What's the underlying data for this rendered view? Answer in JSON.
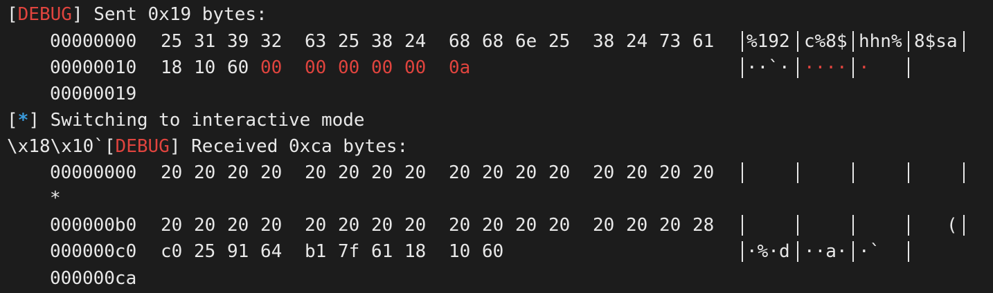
{
  "terminal": {
    "debug_tag": "DEBUG",
    "star_tag": "*",
    "sent_msg": "Sent 0x19 bytes:",
    "switch_msg": "Switching to interactive mode",
    "recv_prefix": "\\x18\\x10`",
    "recv_msg": "Received 0xca bytes:",
    "repeat_marker": "*",
    "sent_rows": [
      {
        "offset": "00000000",
        "bytes": [
          "25",
          "31",
          "39",
          "32",
          "63",
          "25",
          "38",
          "24",
          "68",
          "68",
          "6e",
          "25",
          "38",
          "24",
          "73",
          "61"
        ],
        "red_from": 16,
        "ascii": [
          "%192",
          "c%8$",
          "hhn%",
          "8$sa"
        ],
        "ascii_red": [
          false,
          false,
          false,
          false
        ]
      },
      {
        "offset": "00000010",
        "bytes": [
          "18",
          "10",
          "60",
          "00",
          "00",
          "00",
          "00",
          "00",
          "0a"
        ],
        "red_from": 3,
        "ascii": [
          "··`·",
          "····",
          "·"
        ],
        "ascii_red": [
          false,
          true,
          true
        ]
      },
      {
        "offset": "00000019",
        "bytes": [],
        "red_from": 99,
        "ascii": null,
        "ascii_red": []
      }
    ],
    "recv_rows": [
      {
        "offset": "00000000",
        "bytes": [
          "20",
          "20",
          "20",
          "20",
          "20",
          "20",
          "20",
          "20",
          "20",
          "20",
          "20",
          "20",
          "20",
          "20",
          "20",
          "20"
        ],
        "ascii": [
          "    ",
          "    ",
          "    ",
          "    "
        ]
      },
      {
        "offset": "000000b0",
        "bytes": [
          "20",
          "20",
          "20",
          "20",
          "20",
          "20",
          "20",
          "20",
          "20",
          "20",
          "20",
          "20",
          "20",
          "20",
          "20",
          "28"
        ],
        "ascii": [
          "    ",
          "    ",
          "    ",
          "   ("
        ]
      },
      {
        "offset": "000000c0",
        "bytes": [
          "c0",
          "25",
          "91",
          "64",
          "b1",
          "7f",
          "61",
          "18",
          "10",
          "60"
        ],
        "ascii": [
          "·%·d",
          "··a·",
          "·`"
        ]
      },
      {
        "offset": "000000ca",
        "bytes": [],
        "ascii": null
      }
    ]
  }
}
